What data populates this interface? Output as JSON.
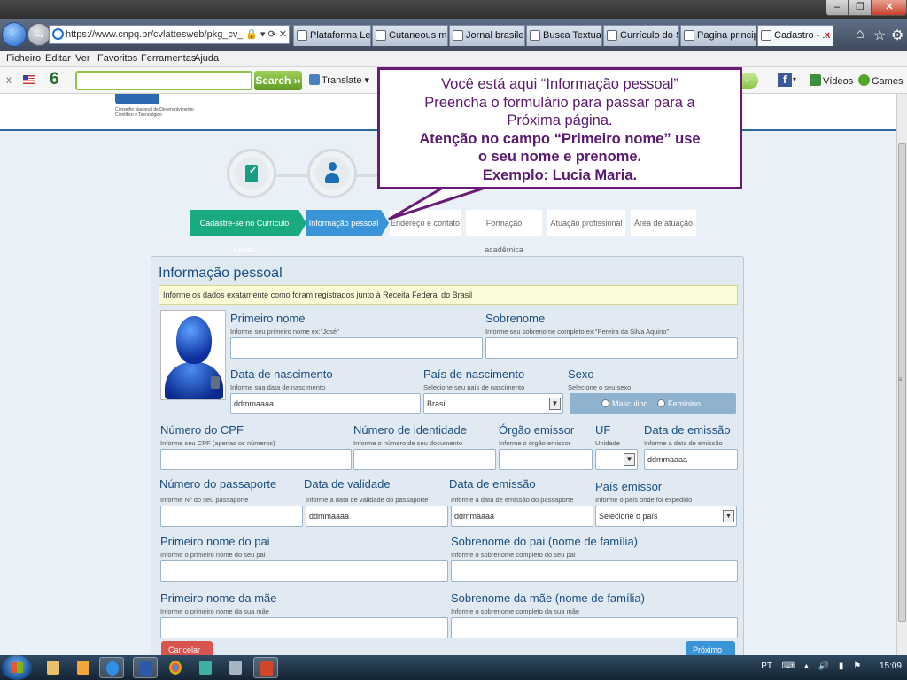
{
  "browser": {
    "url": "https://www.cnpq.br/cvlattesweb/pkg_cv_estr...",
    "tabs": [
      {
        "label": "Plataforma Let..."
      },
      {
        "label": "Cutaneous ma..."
      },
      {
        "label": "Jornal brasileir..."
      },
      {
        "label": "Busca Textual ..."
      },
      {
        "label": "Currículo do Si..."
      },
      {
        "label": "Pagina princip..."
      },
      {
        "label": "Cadastro - ..."
      }
    ],
    "menu": [
      "Ficheiro",
      "Editar",
      "Ver",
      "Favoritos",
      "Ferramentas",
      "Ajuda"
    ],
    "toolbar": {
      "search_button": "Search",
      "translate": "Translate",
      "videos": "Vídeos",
      "games": "Games"
    }
  },
  "page": {
    "logo_text": "Conselho Nacional de Desenvolvimento Científico e Tecnológico",
    "breadcrumb": [
      "Cadastre-se no Currículo Lattes",
      "Informação pessoal",
      "Endereço e contato",
      "Formação acadêmica",
      "Atuação profissional",
      "Área de atuação"
    ],
    "form": {
      "title": "Informação pessoal",
      "notice": "Informe os dados exatamente como foram registrados junto à Receita Federal do Brasil",
      "first_name": {
        "label": "Primeiro nome",
        "hint": "Informe seu primeiro nome ex:\"José\""
      },
      "surname": {
        "label": "Sobrenome",
        "hint": "Informe seu sobrenome completo ex:\"Pereira da Silva Aquino\""
      },
      "birth_date": {
        "label": "Data de nascimento",
        "hint": "Informe sua data de nascimento",
        "value": "ddmmaaaa"
      },
      "birth_country": {
        "label": "País de nascimento",
        "hint": "Selecione seu país de nascimento",
        "value": "Brasil"
      },
      "sex": {
        "label": "Sexo",
        "hint": "Selecione o seu sexo",
        "male": "Masculino",
        "female": "Feminino"
      },
      "cpf": {
        "label": "Número do CPF",
        "hint": "Informe seu CPF (apenas os números)"
      },
      "id_number": {
        "label": "Número de identidade",
        "hint": "Informe o número de seu documento"
      },
      "issuer": {
        "label": "Órgão emissor",
        "hint": "Informe o órgão emissor"
      },
      "uf": {
        "label": "UF",
        "hint": "Unidade"
      },
      "issue_date": {
        "label": "Data de emissão",
        "hint": "Informe a data de emissão",
        "value": "ddmmaaaa"
      },
      "passport": {
        "label": "Número do passaporte",
        "hint": "Informe Nº do seu passaporte"
      },
      "validity": {
        "label": "Data de validade",
        "hint": "Informe a data de validade do passaporte",
        "value": "ddmmaaaa"
      },
      "passport_issue": {
        "label": "Data de emissão",
        "hint": "Informe a data de emissão do passaporte",
        "value": "ddmmaaaa"
      },
      "issuing_country": {
        "label": "País emissor",
        "hint": "Informe o país onde foi expedido",
        "value": "Selecione o país"
      },
      "father_first": {
        "label": "Primeiro nome do pai",
        "hint": "Informe o primeiro nome do seu pai"
      },
      "father_surname": {
        "label": "Sobrenome do pai (nome de família)",
        "hint": "Informe o sobrenome completo do seu pai"
      },
      "mother_first": {
        "label": "Primeiro nome da mãe",
        "hint": "Informe o primeiro nome da sua mãe"
      },
      "mother_surname": {
        "label": "Sobrenome da mãe (nome de família)",
        "hint": "Informe o sobrenome completo da sua mãe"
      },
      "cancel": "Cancelar",
      "next": "Próximo"
    }
  },
  "callout": {
    "line1": "Você está aqui “Informação pessoal”",
    "line2": "Preencha o formulário para passar para a",
    "line3": "Próxima página.",
    "line4": "Atenção no campo “Primeiro nome” use",
    "line5": "o seu nome e prenome.",
    "line6": "Exemplo: Lucia Maria."
  },
  "taskbar": {
    "lang": "PT",
    "clock": "15:09"
  },
  "colors": {
    "accent": "#3a95d8",
    "done": "#1aaa80",
    "callout_border": "#6a1b78",
    "cancel": "#d9534f"
  }
}
